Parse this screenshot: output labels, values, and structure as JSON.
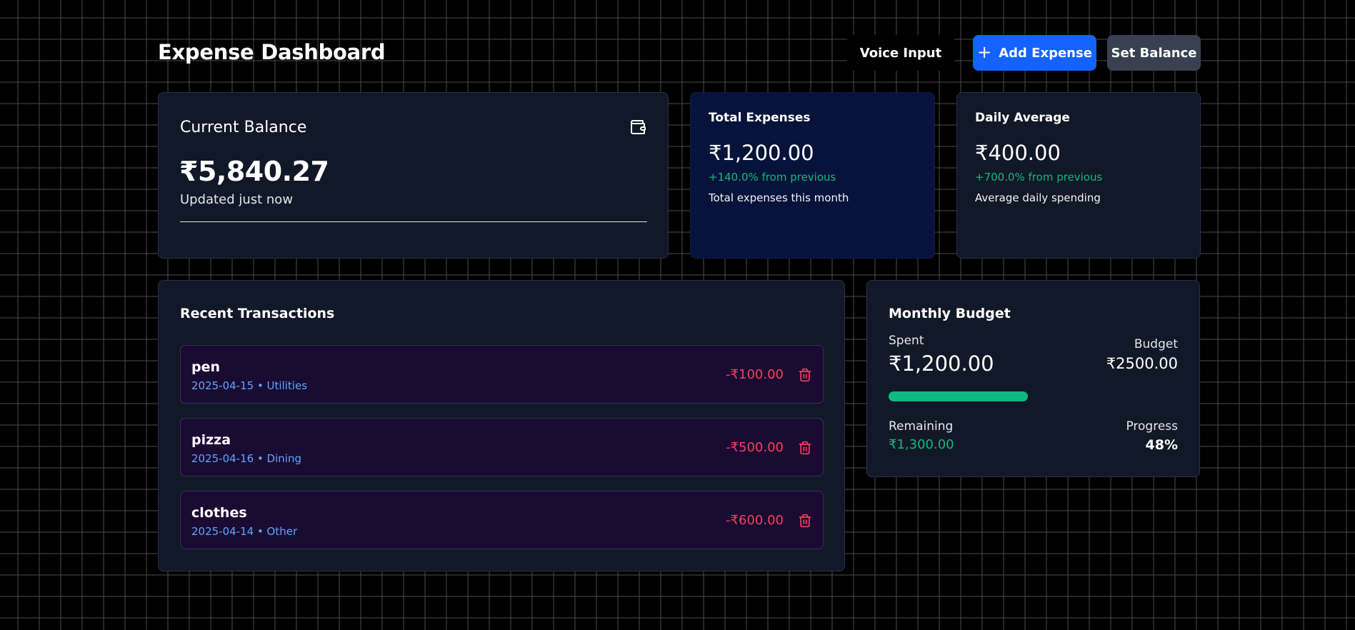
{
  "header": {
    "title": "Expense Dashboard",
    "voice_label": "Voice Input",
    "add_label": "Add Expense",
    "set_balance_label": "Set Balance"
  },
  "balance": {
    "title": "Current Balance",
    "amount": "₹5,840.27",
    "updated": "Updated just now",
    "icon": "wallet-icon"
  },
  "total": {
    "title": "Total Expenses",
    "amount": "₹1,200.00",
    "change": "+140.0% from previous",
    "subtitle": "Total expenses this month"
  },
  "daily": {
    "title": "Daily Average",
    "amount": "₹400.00",
    "change": "+700.0% from previous",
    "subtitle": "Average daily spending"
  },
  "transactions": {
    "title": "Recent Transactions",
    "items": [
      {
        "name": "pen",
        "meta": "2025-04-15 • Utilities",
        "amount": "-₹100.00"
      },
      {
        "name": "pizza",
        "meta": "2025-04-16 • Dining",
        "amount": "-₹500.00"
      },
      {
        "name": "clothes",
        "meta": "2025-04-14 • Other",
        "amount": "-₹600.00"
      }
    ]
  },
  "budget": {
    "title": "Monthly Budget",
    "spent_label": "Spent",
    "spent": "₹1,200.00",
    "budget_label": "Budget",
    "budget": "₹2500.00",
    "remaining_label": "Remaining",
    "remaining": "₹1,300.00",
    "progress_label": "Progress",
    "progress": "48%",
    "progress_fraction": 0.48
  },
  "colors": {
    "accent": "#1463ff",
    "positive": "#10b981",
    "negative": "#f43f5e",
    "meta": "#60a5fa"
  }
}
